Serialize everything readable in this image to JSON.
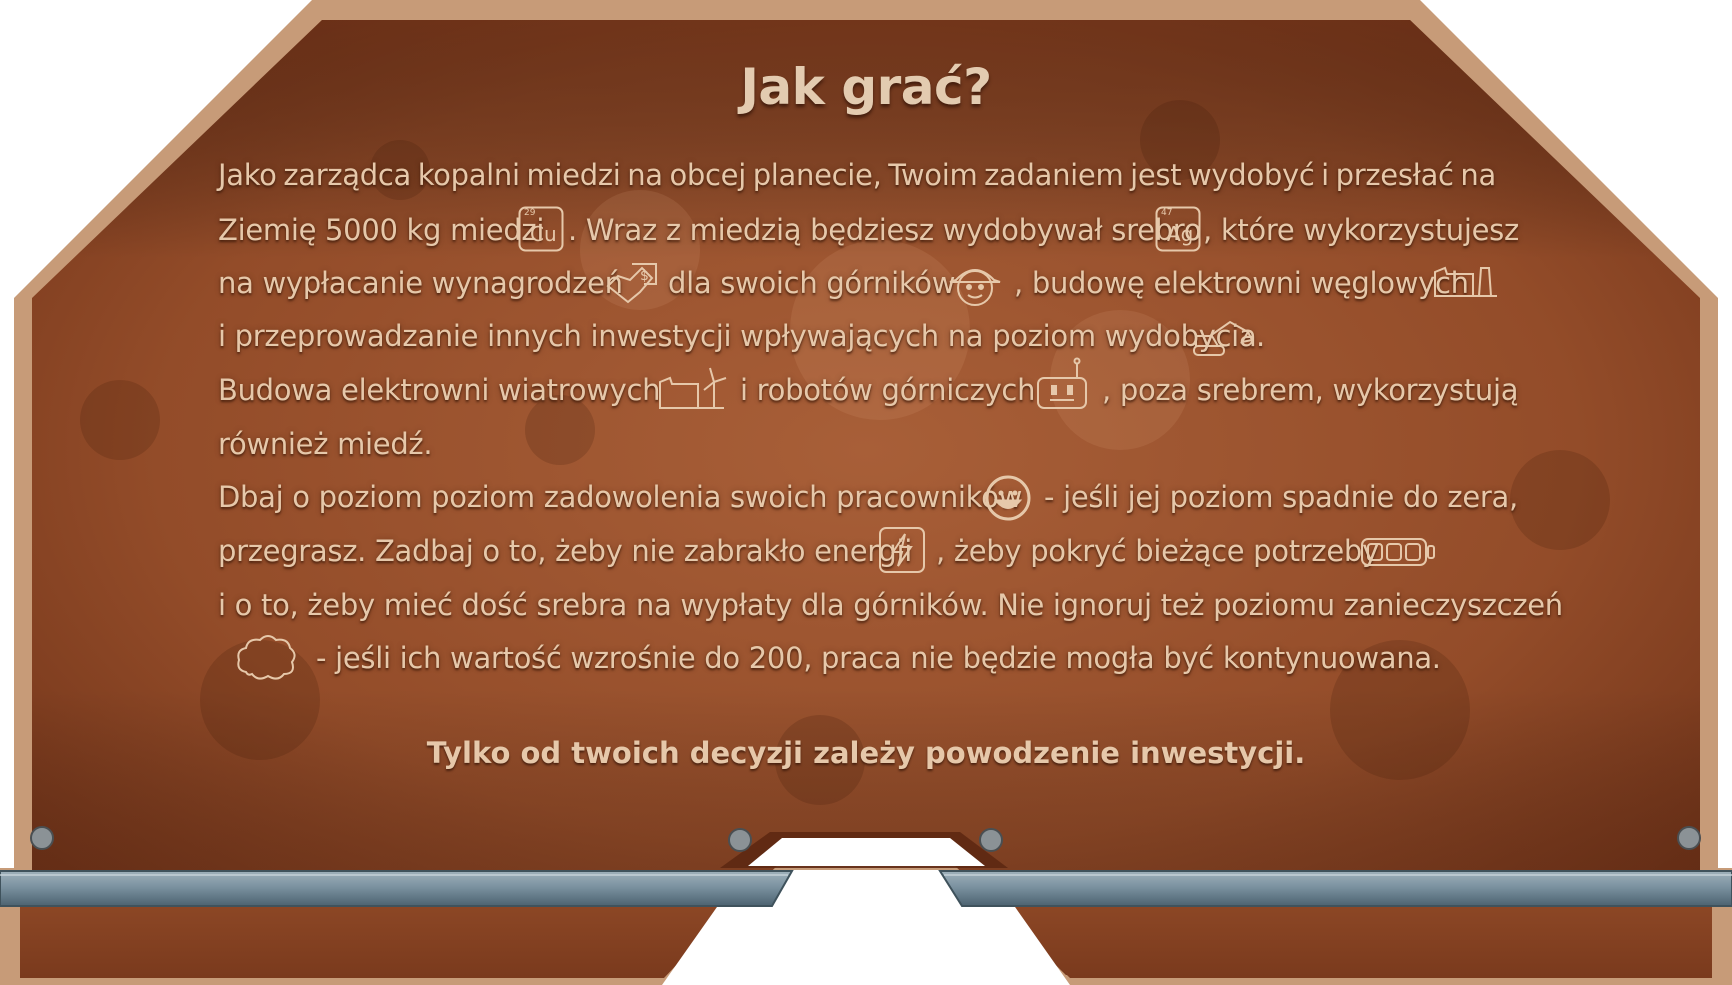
{
  "title": "Jak grać?",
  "icons": {
    "copper_symbol": "Cu",
    "copper_number": "29",
    "silver_symbol": "Ag",
    "silver_number": "47"
  },
  "lines": {
    "l1": [
      "Jako",
      "zarządca",
      "kopalni",
      "miedzi",
      "na",
      "obcej",
      "planecie,",
      "Twoim",
      "zadaniem",
      "jest",
      "wydobyć",
      "i",
      "przesłać",
      "na"
    ],
    "l2a": "Ziemię 5000 kg miedzi",
    "l2b": ". Wraz z miedzią będziesz wydobywał srebro",
    "l2c": ", które wykorzystujesz",
    "l3a": "na wypłacanie wynagrodzeń",
    "l3b": "dla swoich górników",
    "l3c": ", budowę elektrowni węglowych",
    "l4a": "i przeprowadzanie innych inwestycji wpływających na poziom wydobycia",
    "l4b": ".",
    "l5a": "Budowa elektrowni wiatrowych",
    "l5b": "i robotów górniczych",
    "l5c": ", poza srebrem, wykorzystują",
    "l6": "również miedź.",
    "l7a": "Dbaj o poziom poziom zadowolenia swoich pracowników",
    "l7b": "- jeśli jej poziom spadnie do zera,",
    "l8a": "przegrasz. Zadbaj o to, żeby nie zabrakło energii",
    "l8b": ", żeby pokryć bieżące potrzeby",
    "l9": "i o to, żeby mieć dość srebra na wypłaty dla górników. Nie ignoruj też poziomu zanieczyszczeń",
    "l10": "- jeśli ich wartość wzrośnie do 200, praca nie będzie mogła być kontynuowana."
  },
  "tagline": "Tylko od twoich decyzji zależy powodzenie inwestycji.",
  "colors": {
    "panel_copper": "#a35a33",
    "panel_dark": "#5e2a13",
    "frame_tan": "#c99a76",
    "text": "#e6c8aa",
    "steel": "#6f8896"
  }
}
